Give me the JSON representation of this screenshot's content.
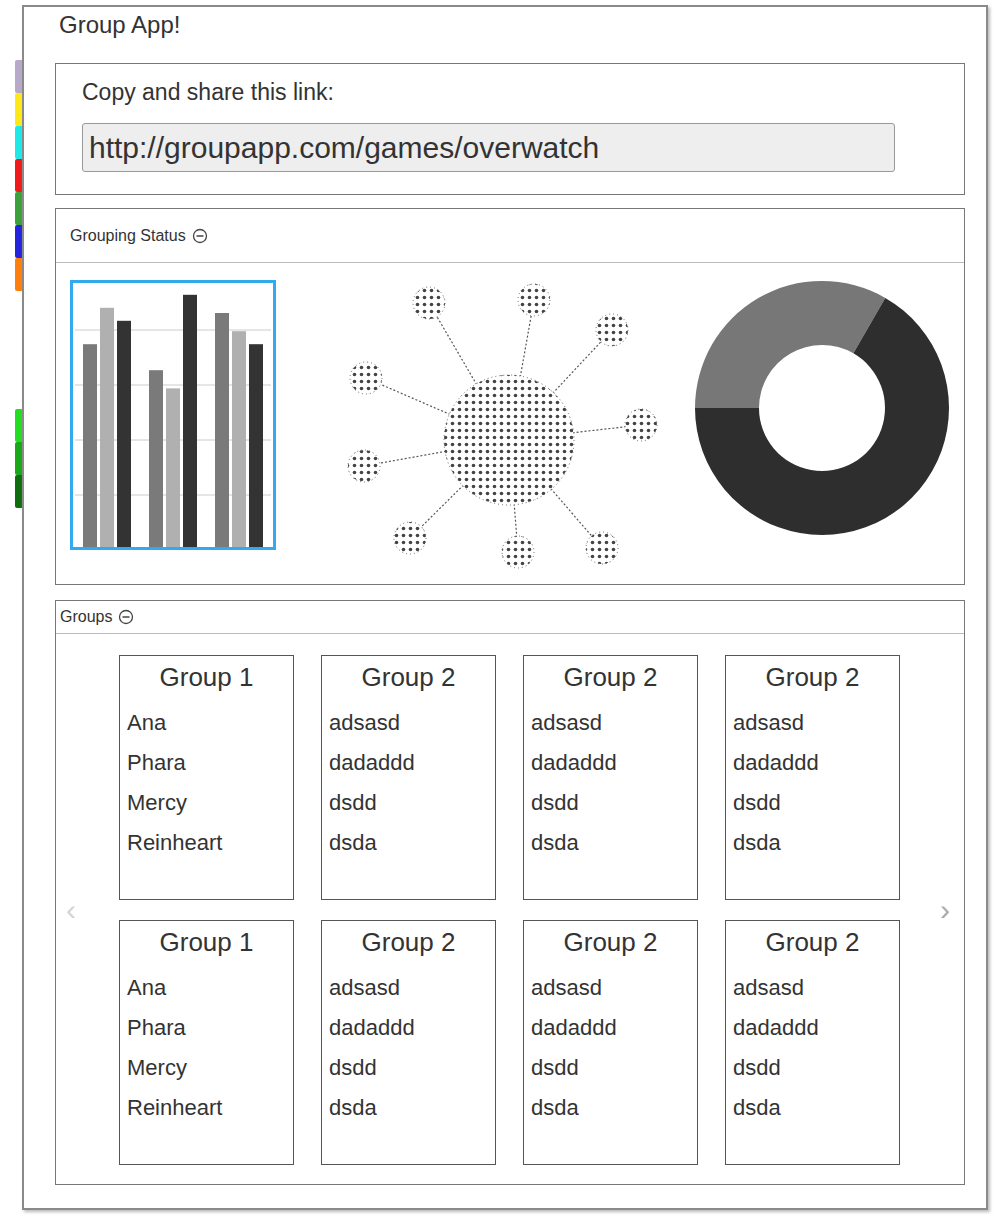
{
  "app": {
    "title": "Group App!"
  },
  "side_tab_groups": [
    {
      "tabs": [
        {
          "color": "#b7a9c9"
        },
        {
          "color": "#ffe81a"
        },
        {
          "color": "#1de9e9"
        },
        {
          "color": "#f01a1a"
        },
        {
          "color": "#3aa23a"
        },
        {
          "color": "#2323e0"
        },
        {
          "color": "#ff7f0e"
        }
      ]
    },
    {
      "tabs": [
        {
          "color": "#22dd22"
        },
        {
          "color": "#18a818"
        },
        {
          "color": "#0e6e0e"
        }
      ]
    }
  ],
  "share": {
    "label": "Copy and share this link:",
    "link": "http://groupapp.com/games/overwatch"
  },
  "status_panel": {
    "title": "Grouping Status",
    "bar_chart": {
      "selected": true,
      "series": [
        {
          "values": [
            78,
            68,
            90
          ],
          "color": "#7a7a7a"
        },
        {
          "values": [
            92,
            61,
            83
          ],
          "color": "#b0b0b0"
        },
        {
          "values": [
            87,
            97,
            78
          ],
          "color": "#333333"
        }
      ]
    },
    "donut_chart": {
      "segments": [
        {
          "value": 33.3,
          "color": "#777777"
        },
        {
          "value": 66.7,
          "color": "#2e2e2e"
        }
      ]
    }
  },
  "groups_panel": {
    "title": "Groups",
    "prev": {
      "label": "‹",
      "disabled": true
    },
    "next": {
      "label": "›",
      "disabled": false
    },
    "groups": [
      {
        "name": "Group 1",
        "members": [
          "Ana",
          "Phara",
          "Mercy",
          "Reinheart"
        ]
      },
      {
        "name": "Group 2",
        "members": [
          "adsasd",
          "dadaddd",
          "dsdd",
          "dsda"
        ]
      },
      {
        "name": "Group 2",
        "members": [
          "adsasd",
          "dadaddd",
          "dsdd",
          "dsda"
        ]
      },
      {
        "name": "Group 2",
        "members": [
          "adsasd",
          "dadaddd",
          "dsdd",
          "dsda"
        ]
      },
      {
        "name": "Group 1",
        "members": [
          "Ana",
          "Phara",
          "Mercy",
          "Reinheart"
        ]
      },
      {
        "name": "Group 2",
        "members": [
          "adsasd",
          "dadaddd",
          "dsdd",
          "dsda"
        ]
      },
      {
        "name": "Group 2",
        "members": [
          "adsasd",
          "dadaddd",
          "dsdd",
          "dsda"
        ]
      },
      {
        "name": "Group 2",
        "members": [
          "adsasd",
          "dadaddd",
          "dsdd",
          "dsda"
        ]
      }
    ]
  }
}
